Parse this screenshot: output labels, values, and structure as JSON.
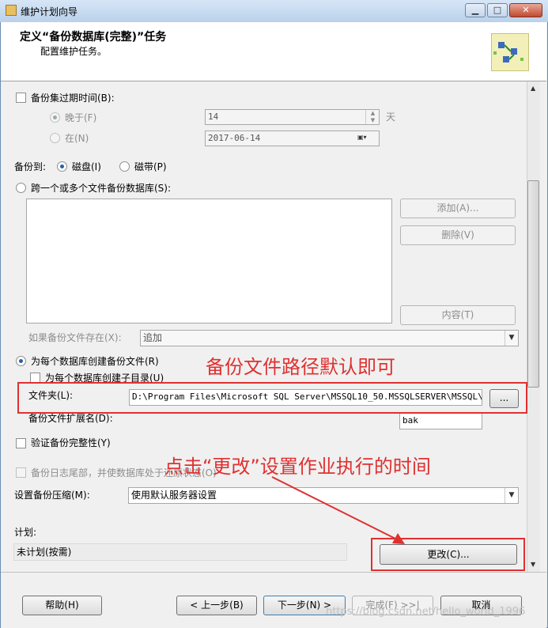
{
  "window": {
    "title": "维护计划向导",
    "min_glyph": "▁",
    "max_glyph": "□",
    "close_glyph": "✕"
  },
  "header": {
    "title": "定义“备份数据库(完整)”任务",
    "subtitle": "配置维护任务。"
  },
  "backup_set_expire": {
    "label": "备份集过期时间(B):",
    "after_label": "晚于(F)",
    "after_value": "14",
    "after_unit": "天",
    "on_label": "在(N)",
    "on_value": "2017-06-14"
  },
  "backup_to": {
    "label": "备份到:",
    "disk_label": "磁盘(I)",
    "tape_label": "磁带(P)"
  },
  "span_files": {
    "label": "跨一个或多个文件备份数据库(S):",
    "add_button": "添加(A)...",
    "remove_button": "删除(V)",
    "contents_button": "内容(T)"
  },
  "if_exists": {
    "label": "如果备份文件存在(X):",
    "value": "追加"
  },
  "per_db": {
    "label": "为每个数据库创建备份文件(R)",
    "subdir_label": "为每个数据库创建子目录(U)",
    "folder_label": "文件夹(L):",
    "folder_value": "D:\\Program Files\\Microsoft SQL Server\\MSSQL10_50.MSSQLSERVER\\MSSQL\\B",
    "browse_button": "...",
    "ext_label": "备份文件扩展名(D):",
    "ext_value": "bak"
  },
  "verify": {
    "label": "验证备份完整性(Y)"
  },
  "tail_log": {
    "label": "备份日志尾部，并使数据库处于还原状态(O)"
  },
  "compression": {
    "label": "设置备份压缩(M):",
    "value": "使用默认服务器设置"
  },
  "schedule": {
    "label": "计划:",
    "value": "未计划(按需)",
    "change_button": "更改(C)..."
  },
  "footer": {
    "help": "帮助(H)",
    "back": "< 上一步(B)",
    "next": "下一步(N) >",
    "finish": "完成(F) >>|",
    "cancel": "取消"
  },
  "annotations": {
    "folder_note": "备份文件路径默认即可",
    "schedule_note": "点击“更改”设置作业执行的时间",
    "color": "#e03030"
  },
  "watermark": "https://blog.csdn.net/hello_world_1996"
}
